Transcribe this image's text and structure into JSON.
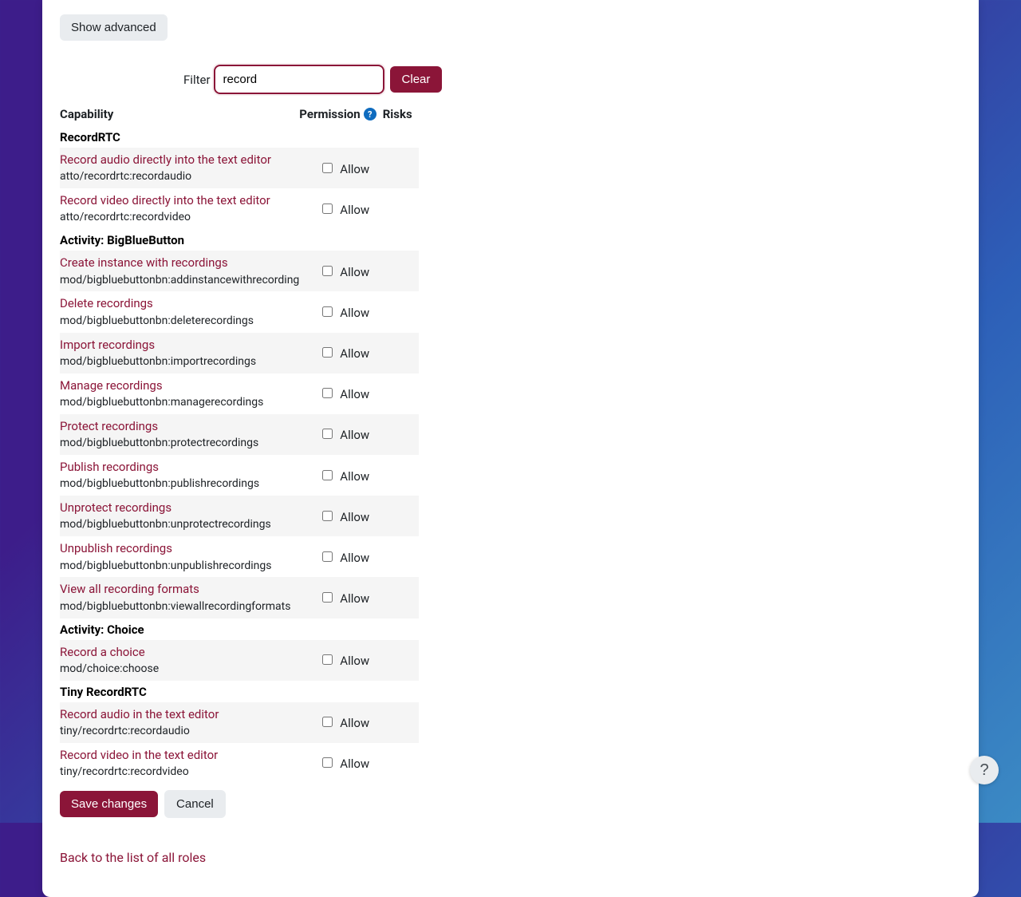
{
  "show_advanced": "Show advanced",
  "filter": {
    "label": "Filter",
    "value": "record",
    "clear": "Clear"
  },
  "headers": {
    "capability": "Capability",
    "permission": "Permission",
    "risks": "Risks"
  },
  "allow_text": "Allow",
  "save": "Save changes",
  "cancel": "Cancel",
  "back": "Back to the list of all roles",
  "groups": [
    {
      "title": "RecordRTC",
      "rows": [
        {
          "label": "Record audio directly into the text editor",
          "code": "atto/recordrtc:recordaudio",
          "alt": true
        },
        {
          "label": "Record video directly into the text editor",
          "code": "atto/recordrtc:recordvideo",
          "alt": false
        }
      ]
    },
    {
      "title": "Activity: BigBlueButton",
      "rows": [
        {
          "label": "Create instance with recordings",
          "code": "mod/bigbluebuttonbn:addinstancewithrecording",
          "alt": true
        },
        {
          "label": "Delete recordings",
          "code": "mod/bigbluebuttonbn:deleterecordings",
          "alt": false
        },
        {
          "label": "Import recordings",
          "code": "mod/bigbluebuttonbn:importrecordings",
          "alt": true
        },
        {
          "label": "Manage recordings",
          "code": "mod/bigbluebuttonbn:managerecordings",
          "alt": false
        },
        {
          "label": "Protect recordings",
          "code": "mod/bigbluebuttonbn:protectrecordings",
          "alt": true
        },
        {
          "label": "Publish recordings",
          "code": "mod/bigbluebuttonbn:publishrecordings",
          "alt": false
        },
        {
          "label": "Unprotect recordings",
          "code": "mod/bigbluebuttonbn:unprotectrecordings",
          "alt": true
        },
        {
          "label": "Unpublish recordings",
          "code": "mod/bigbluebuttonbn:unpublishrecordings",
          "alt": false
        },
        {
          "label": "View all recording formats",
          "code": "mod/bigbluebuttonbn:viewallrecordingformats",
          "alt": true
        }
      ]
    },
    {
      "title": "Activity: Choice",
      "rows": [
        {
          "label": "Record a choice",
          "code": "mod/choice:choose",
          "alt": true
        }
      ]
    },
    {
      "title": "Tiny RecordRTC",
      "rows": [
        {
          "label": "Record audio in the text editor",
          "code": "tiny/recordrtc:recordaudio",
          "alt": true
        },
        {
          "label": "Record video in the text editor",
          "code": "tiny/recordrtc:recordvideo",
          "alt": false
        }
      ]
    }
  ]
}
